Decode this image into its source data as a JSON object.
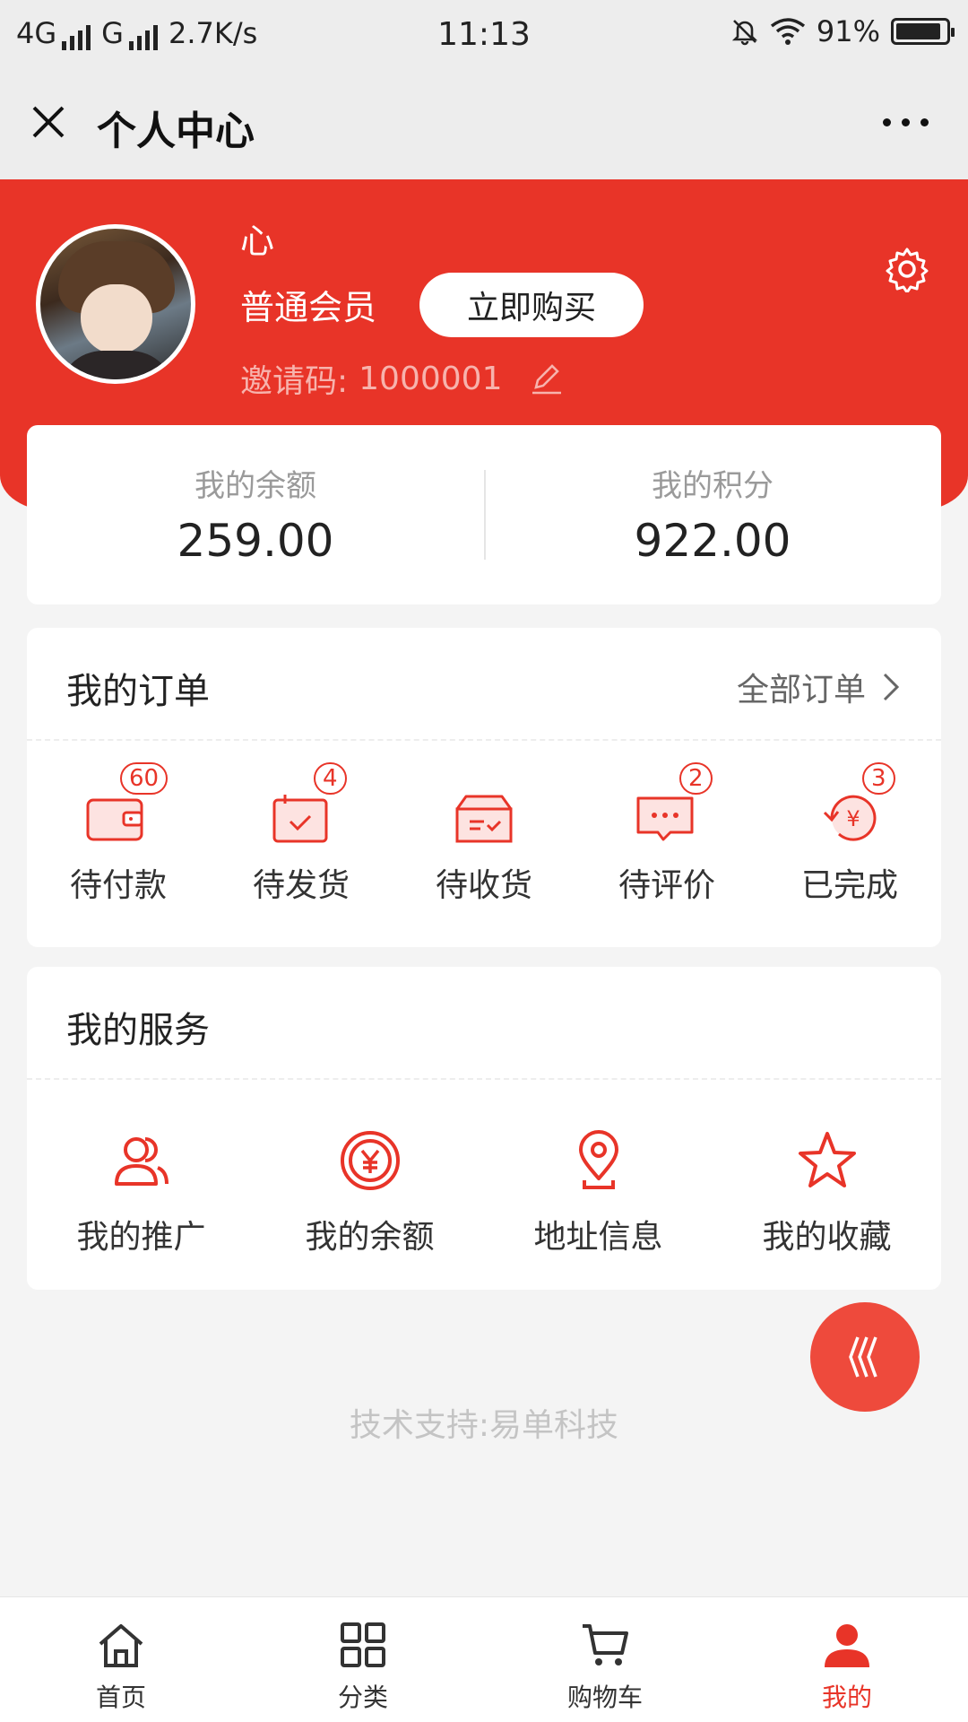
{
  "status_bar": {
    "network_1": "4G",
    "network_2": "G",
    "speed": "2.7K/s",
    "time": "11:13",
    "battery": "91%",
    "battery_level": 0.91
  },
  "nav": {
    "title": "个人中心"
  },
  "profile": {
    "name": "心",
    "member_level": "普通会员",
    "buy_button": "立即购买",
    "invite_label": "邀请码:",
    "invite_code": "1000001"
  },
  "balance": {
    "balance_label": "我的余额",
    "balance_value": "259.00",
    "points_label": "我的积分",
    "points_value": "922.00"
  },
  "orders": {
    "title": "我的订单",
    "all_link": "全部订单",
    "items": [
      {
        "label": "待付款",
        "badge": "60",
        "icon": "wallet-icon"
      },
      {
        "label": "待发货",
        "badge": "4",
        "icon": "package-check-icon"
      },
      {
        "label": "待收货",
        "badge": "",
        "icon": "box-icon"
      },
      {
        "label": "待评价",
        "badge": "2",
        "icon": "comment-icon"
      },
      {
        "label": "已完成",
        "badge": "3",
        "icon": "refund-icon"
      }
    ]
  },
  "services": {
    "title": "我的服务",
    "items": [
      {
        "label": "我的推广",
        "icon": "users-icon"
      },
      {
        "label": "我的余额",
        "icon": "yen-coin-icon"
      },
      {
        "label": "地址信息",
        "icon": "location-pin-icon"
      },
      {
        "label": "我的收藏",
        "icon": "star-icon"
      }
    ]
  },
  "footer": {
    "note": "技术支持:易单科技"
  },
  "tabbar": {
    "items": [
      {
        "label": "首页",
        "icon": "home-icon"
      },
      {
        "label": "分类",
        "icon": "grid-icon"
      },
      {
        "label": "购物车",
        "icon": "cart-icon"
      },
      {
        "label": "我的",
        "icon": "user-icon"
      }
    ],
    "active_color": "#e83428"
  },
  "colors": {
    "brand_red": "#e83428",
    "background": "#f4f4f4"
  }
}
